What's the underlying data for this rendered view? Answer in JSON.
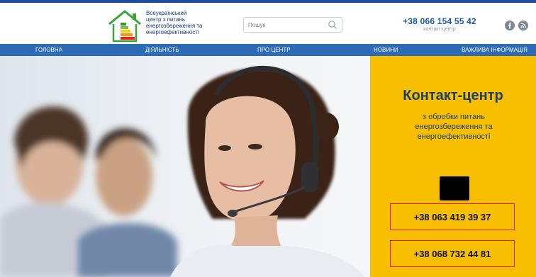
{
  "header": {
    "logo_icon": "house-energy-rating-icon",
    "logo_lines": [
      "Всеукраїнський",
      "центр з питань",
      "енергозбереження та",
      "енергоефективності"
    ],
    "search": {
      "placeholder": "Пошук",
      "icon": "search-icon"
    },
    "phone": {
      "number": "+38 066 154 55 42",
      "subtitle": "контакт-центр"
    },
    "social": [
      {
        "icon": "facebook-icon"
      },
      {
        "icon": "rss-icon"
      }
    ]
  },
  "nav": {
    "items": [
      {
        "label": "ГОЛОВНА"
      },
      {
        "label": "ДІЯЛЬНІСТЬ"
      },
      {
        "label": "ПРО ЦЕНТР"
      },
      {
        "label": "НОВИНИ"
      },
      {
        "label": "ВАЖЛИВА ІНФОРМАЦІЯ"
      }
    ]
  },
  "panel": {
    "title": "Контакт-центр",
    "subtitle": "з обробки питань енергозбереження та енергоефективності",
    "phones": [
      "+38 063 419 39 37",
      "+38 068 732 44 81"
    ]
  },
  "colors": {
    "brand_blue": "#2e6bb7",
    "nav_bg": "#2e6bb7",
    "panel_yellow": "#f7bf00",
    "title_navy": "#1c3f72",
    "highlight_red": "#e01b1b"
  }
}
